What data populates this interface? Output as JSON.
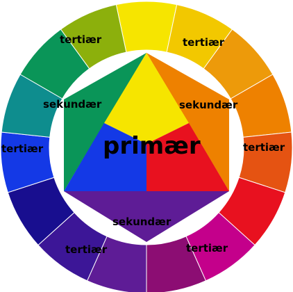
{
  "wheel": {
    "segments": [
      {
        "name": "yellow",
        "color": "#F6E500"
      },
      {
        "name": "yellow-orange",
        "color": "#F2C800"
      },
      {
        "name": "orange-yellow",
        "color": "#ED9A0A"
      },
      {
        "name": "orange",
        "color": "#EE8100"
      },
      {
        "name": "red-orange",
        "color": "#E55312"
      },
      {
        "name": "red",
        "color": "#E8111F"
      },
      {
        "name": "red-violet",
        "color": "#C4008B"
      },
      {
        "name": "violet-red",
        "color": "#8C0D73"
      },
      {
        "name": "violet",
        "color": "#5E1C96"
      },
      {
        "name": "blue-violet",
        "color": "#3C1697"
      },
      {
        "name": "dark-blue",
        "color": "#180E8F"
      },
      {
        "name": "blue",
        "color": "#1439E6"
      },
      {
        "name": "blue-green",
        "color": "#0E8D8E"
      },
      {
        "name": "green",
        "color": "#0A9558"
      },
      {
        "name": "yellow-green",
        "color": "#8CB00C"
      }
    ],
    "tertiary_labels": [
      "tertiær",
      "tertiær",
      "tertiær",
      "tertiær",
      "tertiær",
      "tertiær"
    ],
    "secondary_labels": [
      "sekundær",
      "sekundær",
      "sekundær"
    ],
    "primary_label": "primær",
    "center": {
      "yellow": "#F6E500",
      "red": "#E8111F",
      "blue": "#1439E6",
      "orange": "#EE8100",
      "green": "#0A9558",
      "violet": "#5E1C96"
    }
  }
}
